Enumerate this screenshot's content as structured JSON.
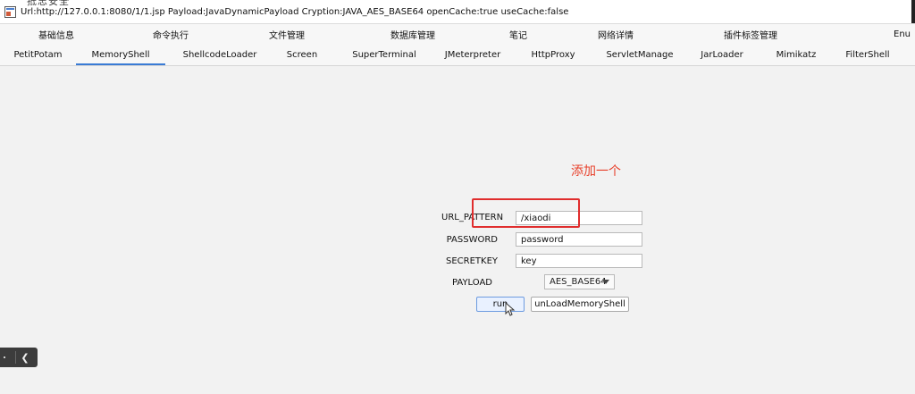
{
  "window": {
    "title": "Url:http://127.0.0.1:8080/1/1.jsp Payload:JavaDynamicPayload Cryption:JAVA_AES_BASE64 openCache:true useCache:false",
    "overlay_text": "抵忠安全"
  },
  "tabs_row1": [
    {
      "label": "基础信息"
    },
    {
      "label": "命令执行"
    },
    {
      "label": "文件管理"
    },
    {
      "label": "数据库管理"
    },
    {
      "label": "笔记"
    },
    {
      "label": "网络详情"
    },
    {
      "label": "插件标签管理"
    },
    {
      "label": "Enu"
    }
  ],
  "tabs_row2": [
    {
      "label": "PetitPotam"
    },
    {
      "label": "MemoryShell",
      "active": true
    },
    {
      "label": "ShellcodeLoader"
    },
    {
      "label": "Screen"
    },
    {
      "label": "SuperTerminal"
    },
    {
      "label": "JMeterpreter"
    },
    {
      "label": "HttpProxy"
    },
    {
      "label": "ServletManage"
    },
    {
      "label": "JarLoader"
    },
    {
      "label": "Mimikatz"
    },
    {
      "label": "FilterShell"
    }
  ],
  "annotation": {
    "text": "添加一个",
    "color": "#e8412c",
    "box_color": "#e02d2d"
  },
  "form": {
    "url_pattern_label": "URL_PATTERN",
    "url_pattern_value": "/xiaodi",
    "password_label": "PASSWORD",
    "password_value": "password",
    "secretkey_label": "SECRETKEY",
    "secretkey_value": "key",
    "payload_label": "PAYLOAD",
    "payload_selected": "AES_BASE64",
    "run_label": "run",
    "unload_label": "unLoadMemoryShell"
  },
  "colors": {
    "accent": "#3a7bd5",
    "background": "#f2f2f2"
  }
}
